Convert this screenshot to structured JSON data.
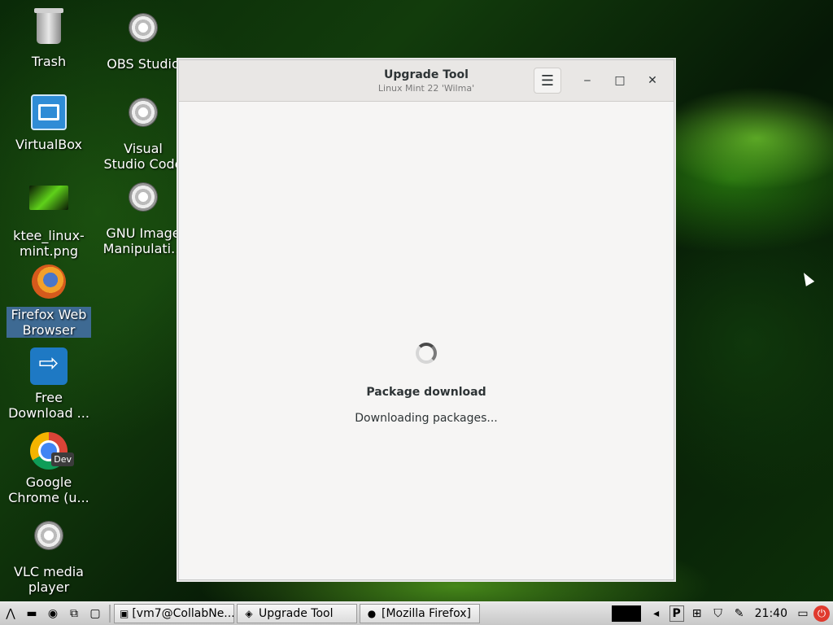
{
  "desktop": {
    "icons": [
      {
        "label": "Trash"
      },
      {
        "label": "OBS Studio"
      },
      {
        "label": "VirtualBox"
      },
      {
        "label": "Visual Studio Code"
      },
      {
        "label": "ktee_linux-mint.png"
      },
      {
        "label": "GNU Image Manipulati..."
      },
      {
        "label": "Firefox Web Browser"
      },
      {
        "label": "Free Download ..."
      },
      {
        "label": "Google Chrome (u..."
      },
      {
        "label": "VLC media player"
      }
    ],
    "chrome_badge": "Dev"
  },
  "window": {
    "title": "Upgrade Tool",
    "subtitle": "Linux Mint 22 'Wilma'",
    "menu_icon": "☰",
    "minimize_icon": "‒",
    "maximize_icon": "□",
    "close_icon": "✕",
    "heading": "Package download",
    "status": "Downloading packages..."
  },
  "taskbar": {
    "tasks": [
      {
        "label": "[vm7@CollabNe..."
      },
      {
        "label": "Upgrade Tool"
      },
      {
        "label": "[Mozilla Firefox]"
      }
    ],
    "clock": "21:40",
    "tray_p": "P"
  }
}
